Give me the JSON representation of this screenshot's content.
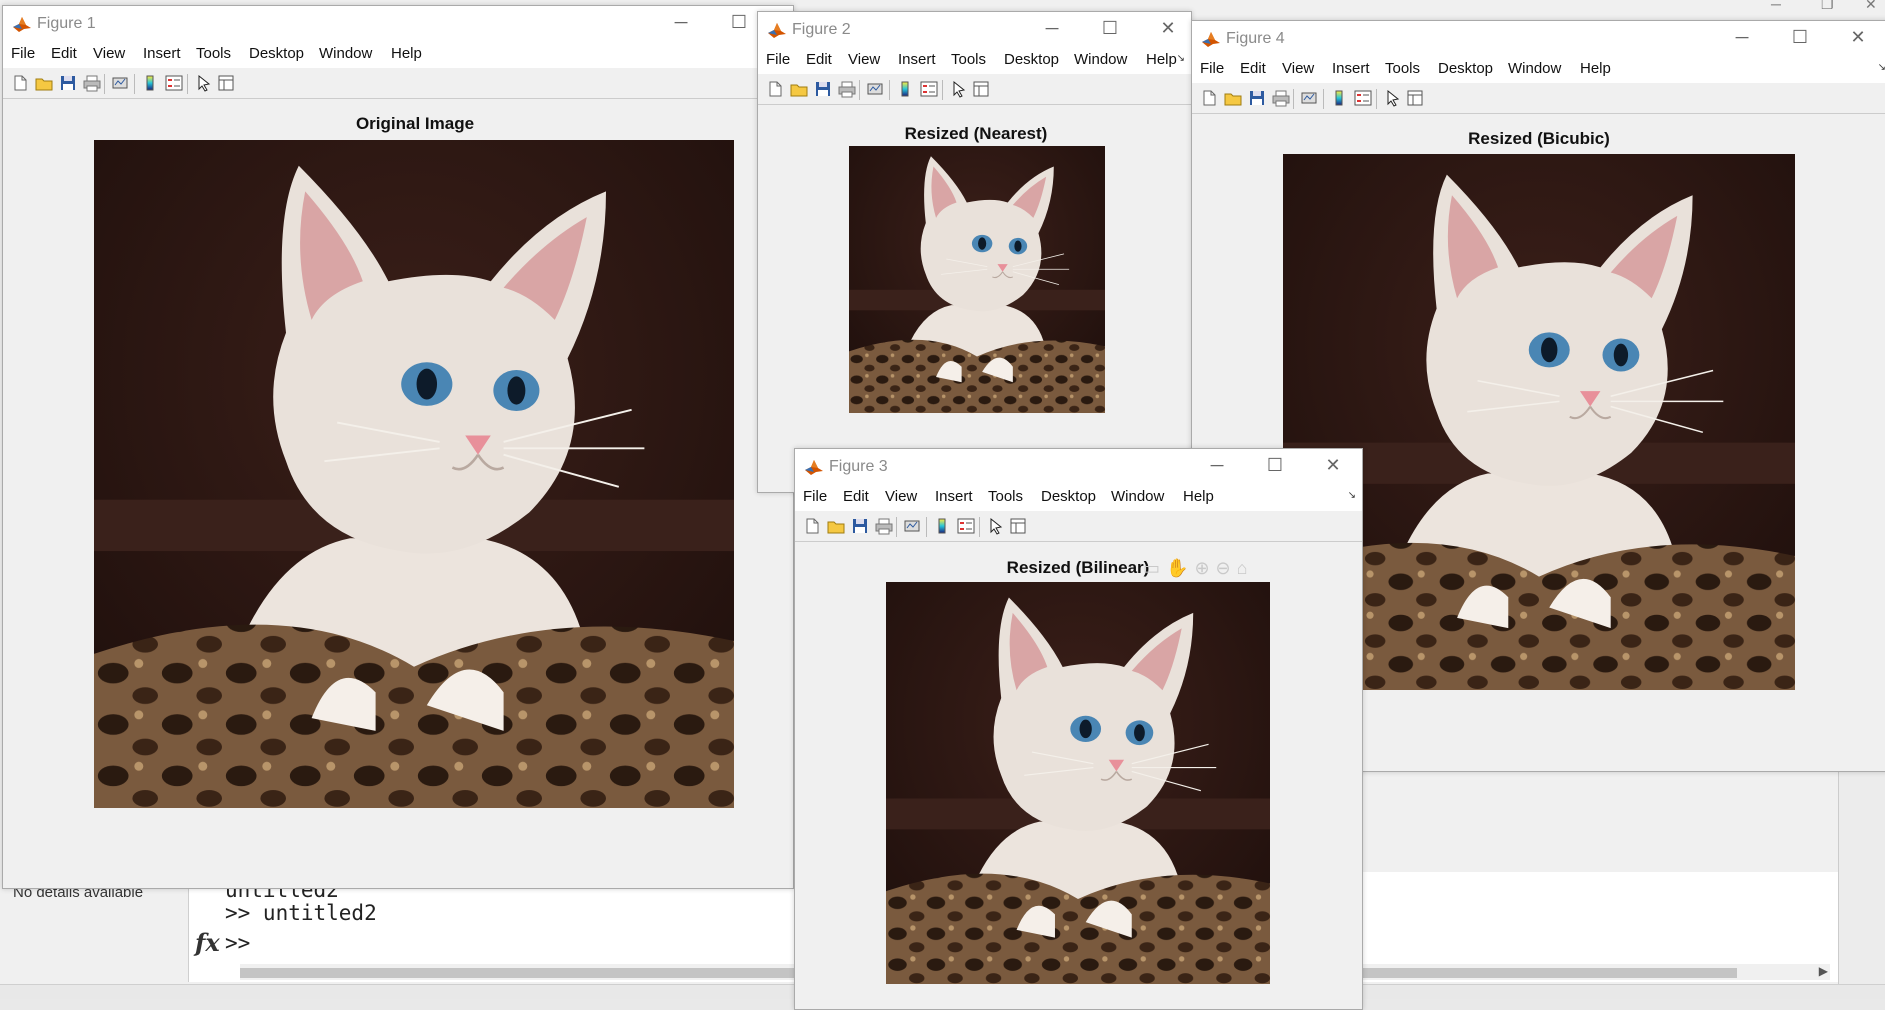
{
  "desktop": {
    "details_text": "No details available",
    "command_lines": [
      "untitled2",
      ">> untitled2",
      ">>"
    ],
    "fx_label": "fx"
  },
  "menu_labels": [
    "File",
    "Edit",
    "View",
    "Insert",
    "Tools",
    "Desktop",
    "Window",
    "Help"
  ],
  "icon_names": {
    "new": "new-file-icon",
    "open": "open-folder-icon",
    "save": "save-icon",
    "print": "print-icon",
    "link": "link-plot-icon",
    "colorbar": "colorbar-icon",
    "legend": "legend-icon",
    "pointer": "edit-plot-pointer-icon",
    "propinspector": "property-inspector-icon"
  },
  "figures": {
    "fig1": {
      "title": "Figure 1",
      "axes_title": "Original Image"
    },
    "fig2": {
      "title": "Figure 2",
      "axes_title": "Resized (Nearest)"
    },
    "fig3": {
      "title": "Figure 3",
      "axes_title": "Resized (Bilinear)"
    },
    "fig4": {
      "title": "Figure 4",
      "axes_title": "Resized (Bicubic)"
    }
  },
  "colors": {
    "titlebar_bg": "#ffffff",
    "figure_bg": "#f0f0f0",
    "matlab_logo": "#d35400"
  }
}
